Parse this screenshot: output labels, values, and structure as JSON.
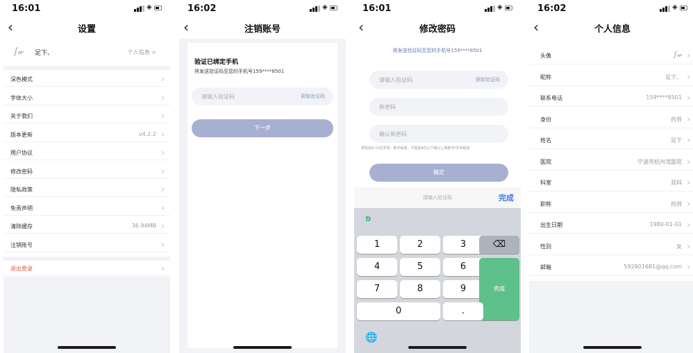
{
  "screens": {
    "settings": {
      "time": "16:01",
      "title": "设置",
      "user": {
        "name": "足下、",
        "info_link": "个人信息 >"
      },
      "rows": [
        {
          "label": "深色模式",
          "value": ""
        },
        {
          "label": "字体大小",
          "value": ""
        },
        {
          "label": "关于我们",
          "value": ""
        },
        {
          "label": "版本更新",
          "value": "v4.2.2"
        },
        {
          "label": "用户协议",
          "value": ""
        },
        {
          "label": "修改密码",
          "value": ""
        },
        {
          "label": "隐私政策",
          "value": ""
        },
        {
          "label": "免责声明",
          "value": ""
        },
        {
          "label": "清除缓存",
          "value": "36.94MB"
        },
        {
          "label": "注销账号",
          "value": ""
        }
      ],
      "logout": "退出登录"
    },
    "cancel_account": {
      "time": "16:02",
      "title": "注销账号",
      "heading": "验证已绑定手机",
      "sub": "将发送验证码至您的手机号159****8501",
      "code_placeholder": "请输入验证码",
      "get_code": "获取验证码",
      "next": "下一步"
    },
    "change_password": {
      "time": "16:01",
      "title": "修改密码",
      "note": "将发送验证码至您的手机号159****8501",
      "code_placeholder": "请输入验证码",
      "get_code": "获取验证码",
      "new_pwd_placeholder": "新密码",
      "confirm_placeholder": "确认新密码",
      "hint": "密码由8-12位字母、数字组成，不能是8位以下或以上纯数字/字母组成",
      "confirm": "确定",
      "keyboard": {
        "placeholder": "请输入验证码",
        "done": "完成",
        "keys": [
          "1",
          "2",
          "3",
          "4",
          "5",
          "6",
          "7",
          "8",
          "9",
          "0",
          "."
        ],
        "enter": "完成"
      }
    },
    "profile": {
      "time": "16:02",
      "title": "个人信息",
      "rows": [
        {
          "label": "头像",
          "value": ""
        },
        {
          "label": "昵称",
          "value": "足下、"
        },
        {
          "label": "联系电话",
          "value": "159****8501"
        },
        {
          "label": "身份",
          "value": "药师"
        },
        {
          "label": "姓名",
          "value": "足下"
        },
        {
          "label": "医院",
          "value": "宁波市杭州湾医院"
        },
        {
          "label": "科室",
          "value": "耳科"
        },
        {
          "label": "职称",
          "value": "药师"
        },
        {
          "label": "出生日期",
          "value": "1980-01-01"
        },
        {
          "label": "性别",
          "value": "女"
        },
        {
          "label": "邮箱",
          "value": "592801681@qq.com"
        }
      ]
    }
  }
}
